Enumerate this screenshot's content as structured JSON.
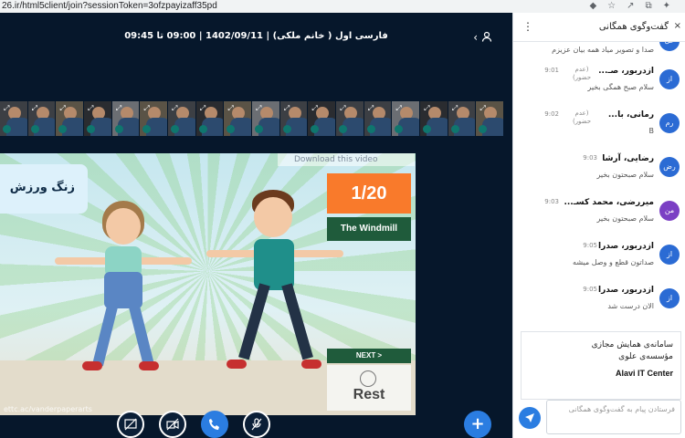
{
  "browser": {
    "url": "26.ir/html5client/join?sessionToken=3ofzpayizaff35pd"
  },
  "meeting": {
    "title": "فارسی اول ( خانم ملکی) | 1402/09/11 | 09:00 تا 09:45"
  },
  "video": {
    "download_label": "Download this video",
    "title_card": "زنگ ورزش",
    "counter": "1/20",
    "exercise": "The Windmill",
    "next_label": "NEXT >",
    "rest_label": "Rest",
    "footer_url": "ettc.ac/vanderpaperarts"
  },
  "chat": {
    "title": "گفت‌وگوی همگانی",
    "messages": [
      {
        "initials": "عل",
        "name": "",
        "status": "",
        "time": "",
        "text": "صدا و تصویر میاد همه بیان عزیزم"
      },
      {
        "initials": "از",
        "name": "ازدربور، صـ...",
        "status": "(عدم حضور)",
        "time": "9:01",
        "text": "سلام صبح همگی بخیر"
      },
      {
        "initials": "رم",
        "name": "رمانی، با...",
        "status": "(عدم حضور)",
        "time": "9:02",
        "text": "B"
      },
      {
        "initials": "رض",
        "name": "رضایی، آرشا",
        "status": "",
        "time": "9:03",
        "text": "سلام صبحتون بخیر"
      },
      {
        "initials": "من",
        "name": "میررضی، محمد کسـ...",
        "status": "",
        "time": "9:03",
        "text": "سلام صبحتون بخیر"
      },
      {
        "initials": "از",
        "name": "ازدربور، صدرا",
        "status": "",
        "time": "9:05",
        "text": "صداتون قطع و وصل میشه"
      },
      {
        "initials": "از",
        "name": "ازدربور، صدرا",
        "status": "",
        "time": "9:05",
        "text": "الان درست شد"
      }
    ],
    "info": {
      "line1": "سامانه‌ی همایش مجازی",
      "line2": "مؤسسه‌ی علوی",
      "line3": "Alavi IT Center"
    },
    "composer_placeholder": "فرستادن پیام به گفت‌وگوی همگانی"
  },
  "thumbnails": 18,
  "colors": {
    "accent": "#2b7de1",
    "background": "#06172b"
  }
}
